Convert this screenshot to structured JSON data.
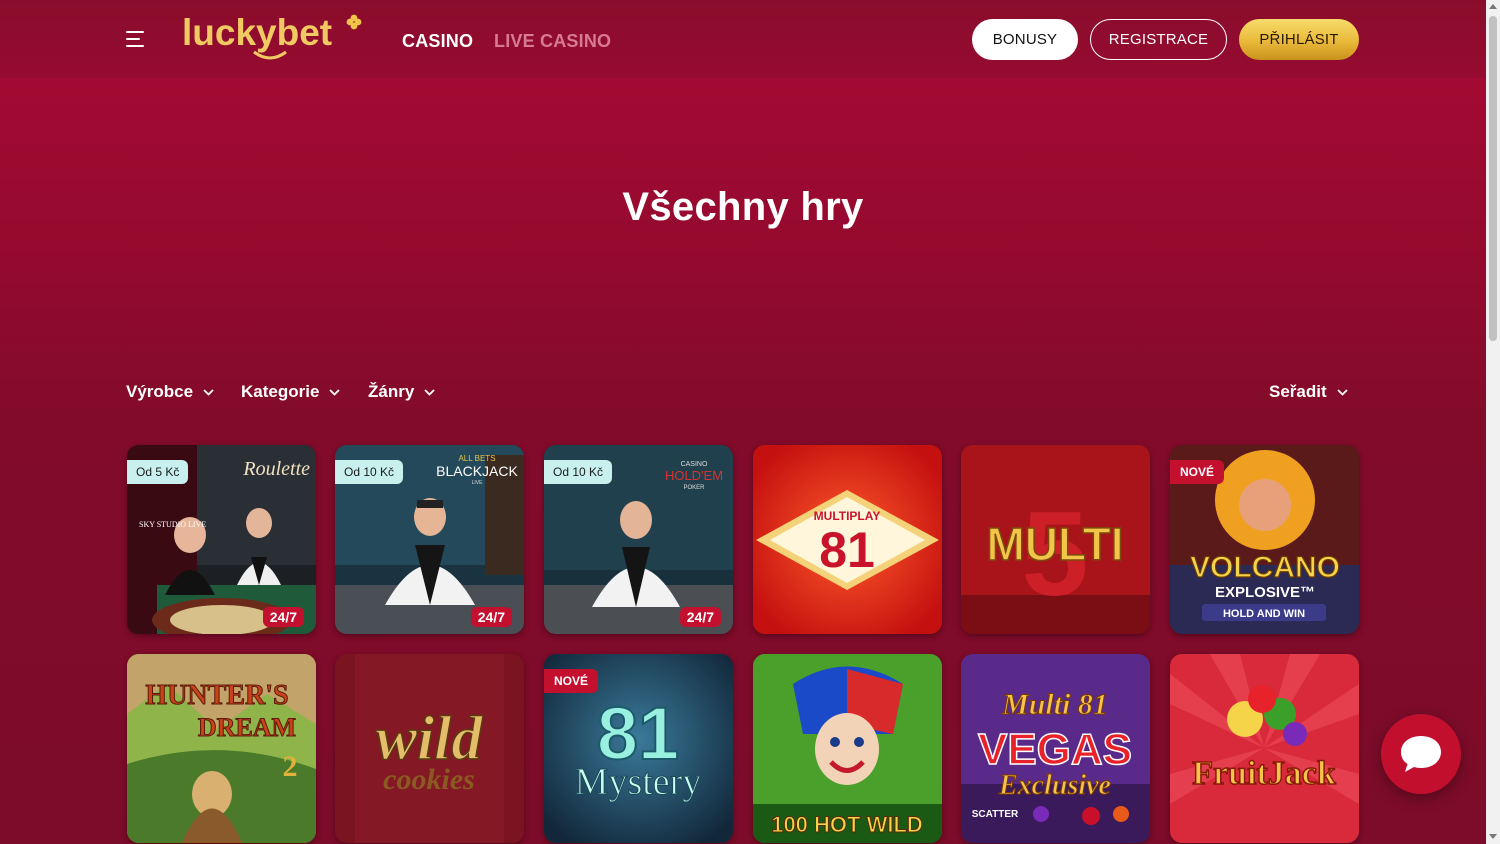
{
  "header": {
    "logo_text": "luckybet",
    "nav": {
      "casino": "CASINO",
      "live_casino": "LIVE CASINO"
    },
    "buttons": {
      "bonusy": "BONUSY",
      "registrace": "REGISTRACE",
      "prihlasit": "PŘIHLÁSIT"
    }
  },
  "page": {
    "title": "Všechny hry"
  },
  "filters": {
    "vyrobce": "Výrobce",
    "kategorie": "Kategorie",
    "zanry": "Žánry",
    "seradit": "Seřadit"
  },
  "games": [
    {
      "name": "Roulette",
      "badge": "Od 5 Kč",
      "tag": "24/7"
    },
    {
      "name": "BLACKJACK",
      "badge": "Od 10 Kč",
      "tag": "24/7"
    },
    {
      "name": "HOLD'EM",
      "badge": "Od 10 Kč",
      "tag": "24/7"
    },
    {
      "name": "MULTIPLAY 81"
    },
    {
      "name": "MULTI 5"
    },
    {
      "name": "VOLCANO EXPLOSIVE HOLD AND WIN",
      "badge": "NOVÉ"
    },
    {
      "name": "HUNTER'S DREAM 2"
    },
    {
      "name": "wild cookies"
    },
    {
      "name": "81 Mystery",
      "badge": "NOVÉ"
    },
    {
      "name": "100 HOT WILD"
    },
    {
      "name": "Multi 81 VEGAS Exclusive"
    },
    {
      "name": "FruitJack"
    }
  ],
  "game_art_text": {
    "roulette": "Roulette",
    "roulette_studio": "SKY STUDIO LIVE",
    "blackjack_top": "ALL BETS",
    "blackjack": "BLACKJACK",
    "blackjack_sub": "LIVE",
    "holdem_top": "CASINO",
    "holdem": "HOLD'EM",
    "holdem_sub": "POKER",
    "multiplay": "MULTIPLAY",
    "multiplay_num": "81",
    "multi5": "MULTI",
    "multi5_num": "5",
    "volcano": "VOLCANO",
    "volcano_sub": "EXPLOSIVE™",
    "volcano_hold": "HOLD AND WIN",
    "hunters_1": "HUNTER'S",
    "hunters_2": "DREAM",
    "hunters_num": "2",
    "wild_1": "wild",
    "wild_2": "cookies",
    "mystery_num": "81",
    "mystery": "Mystery",
    "hotwild": "100 HOT WILD",
    "vegas_top": "Multi 81",
    "vegas": "VEGAS",
    "vegas_sub": "Exclusive",
    "vegas_scatter": "SCATTER",
    "fruitjack": "FruitJack"
  },
  "icons": {
    "menu": "hamburger-icon",
    "chevron": "chevron-down-icon",
    "chat": "chat-bubble-icon"
  },
  "colors": {
    "accent_red": "#c4102f",
    "gold": "#e9b93a",
    "badge_teal": "#c8f0ee"
  }
}
